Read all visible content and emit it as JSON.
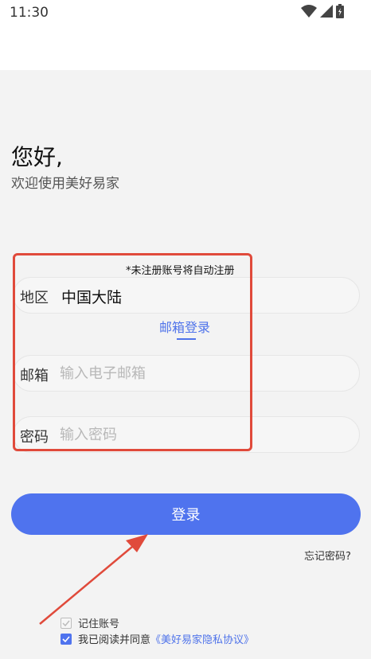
{
  "status": {
    "time": "11:30"
  },
  "greeting": {
    "title": "您好,",
    "subtitle": "欢迎使用美好易家"
  },
  "form": {
    "notice": "*未注册账号将自动注册",
    "region": {
      "label": "地区",
      "value": "中国大陆"
    },
    "tab_label": "邮箱登录",
    "email": {
      "label": "邮箱",
      "placeholder": "输入电子邮箱"
    },
    "password": {
      "label": "密码",
      "placeholder": "输入密码"
    }
  },
  "actions": {
    "login_label": "登录",
    "forgot_label": "忘记密码?"
  },
  "options": {
    "remember_label": "记住账号",
    "agree_prefix": "我已阅读并同意",
    "agreement_link": "《美好易家隐私协议》"
  },
  "colors": {
    "accent": "#4f73ee",
    "annotation": "#e04a3b"
  },
  "icons": [
    "wifi-icon",
    "signal-icon",
    "battery-icon",
    "check-icon"
  ]
}
